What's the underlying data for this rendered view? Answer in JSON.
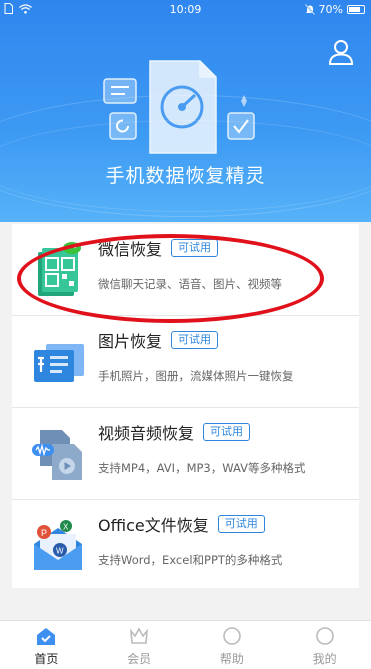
{
  "status_bar": {
    "time": "10:09",
    "battery": "70%"
  },
  "app": {
    "title": "手机数据恢复精灵"
  },
  "items": [
    {
      "title": "微信恢复",
      "badge": "可试用",
      "desc": "微信聊天记录、语音、图片、视频等",
      "icon": "wechat-doc-icon"
    },
    {
      "title": "图片恢复",
      "badge": "可试用",
      "desc": "手机照片，图册，流媒体照片一键恢复",
      "icon": "image-icon"
    },
    {
      "title": "视频音频恢复",
      "badge": "可试用",
      "desc": "支持MP4，AVI，MP3，WAV等多种格式",
      "icon": "video-audio-icon"
    },
    {
      "title": "Office文件恢复",
      "badge": "可试用",
      "desc": "支持Word，Excel和PPT的多种格式",
      "icon": "office-file-icon"
    }
  ],
  "tabs": [
    {
      "label": "首页",
      "active": true
    },
    {
      "label": "会员",
      "active": false
    },
    {
      "label": "帮助",
      "active": false
    },
    {
      "label": "我的",
      "active": false
    }
  ],
  "colors": {
    "header": "#2f86ee",
    "accent": "#2e86de",
    "annotation": "#e0111a"
  }
}
